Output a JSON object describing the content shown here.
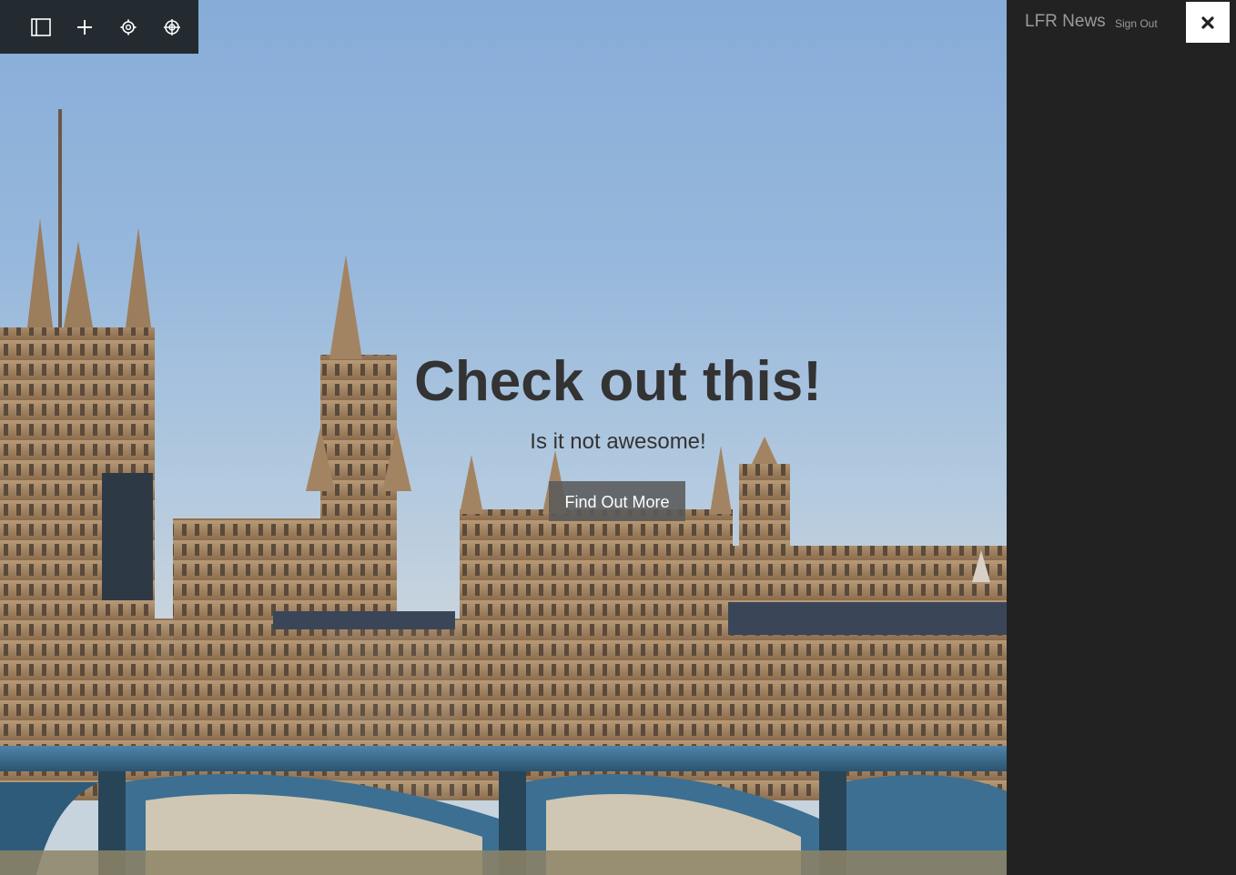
{
  "toolbar": {
    "buttons": [
      {
        "icon": "sidebar-toggle-icon"
      },
      {
        "icon": "plus-icon"
      },
      {
        "icon": "gear-icon"
      },
      {
        "icon": "target-icon"
      }
    ],
    "background": "#232a30"
  },
  "hero": {
    "title": "Check out this!",
    "subtitle": "Is it not awesome!",
    "button_label": "Find Out More",
    "background_image": "houses-of-parliament-london"
  },
  "side_panel": {
    "brand": "LFR News",
    "sign_out": "Sign Out",
    "close_icon": "close-icon",
    "background": "#222222"
  }
}
